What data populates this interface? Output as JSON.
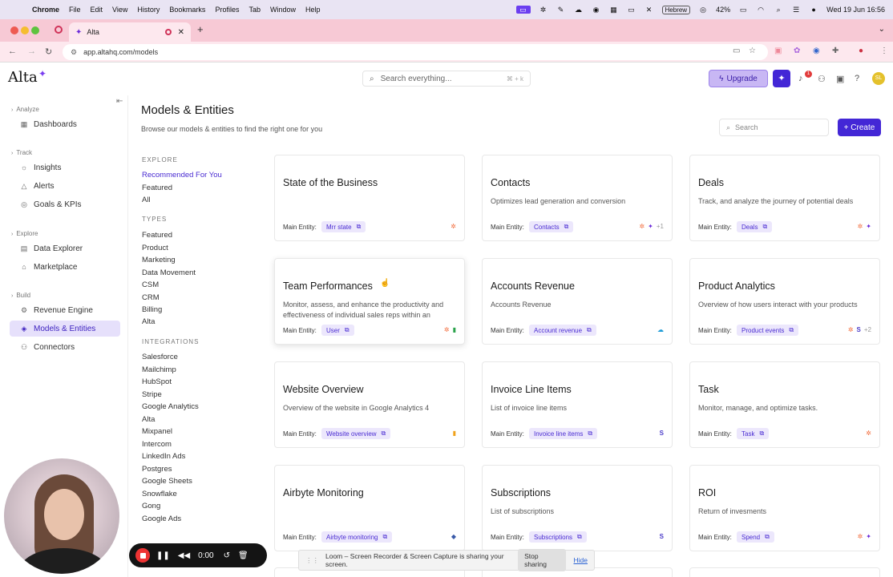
{
  "menubar": {
    "app": "Chrome",
    "items": [
      "File",
      "Edit",
      "View",
      "History",
      "Bookmarks",
      "Profiles",
      "Tab",
      "Window",
      "Help"
    ],
    "language": "Hebrew",
    "battery": "42%",
    "datetime": "Wed 19 Jun  16:56"
  },
  "browser": {
    "tab_title": "Alta",
    "url": "app.altahq.com/models"
  },
  "header": {
    "logo": "Alta",
    "search_placeholder": "Search everything...",
    "search_shortcut": "⌘ + k",
    "upgrade_label": "Upgrade",
    "notification_count": "1",
    "avatar_initials": "SL"
  },
  "sidebar": {
    "sections": [
      {
        "title": "Analyze",
        "items": [
          {
            "label": "Dashboards",
            "icon": "grid-icon"
          }
        ]
      },
      {
        "title": "Track",
        "items": [
          {
            "label": "Insights",
            "icon": "lightbulb-icon"
          },
          {
            "label": "Alerts",
            "icon": "alert-icon"
          },
          {
            "label": "Goals & KPIs",
            "icon": "target-icon"
          }
        ]
      },
      {
        "title": "Explore",
        "items": [
          {
            "label": "Data Explorer",
            "icon": "database-icon"
          },
          {
            "label": "Marketplace",
            "icon": "store-icon"
          }
        ]
      },
      {
        "title": "Build",
        "items": [
          {
            "label": "Revenue Engine",
            "icon": "engine-icon"
          },
          {
            "label": "Models & Entities",
            "icon": "cube-icon",
            "active": true
          },
          {
            "label": "Connectors",
            "icon": "plug-icon"
          }
        ]
      }
    ]
  },
  "main": {
    "title": "Models & Entities",
    "subtitle": "Browse our models & entities to find the right one for you",
    "search_placeholder": "Search",
    "create_label": "+ Create"
  },
  "filters": {
    "explore_heading": "EXPLORE",
    "explore": [
      "Recommended For You",
      "Featured",
      "All"
    ],
    "types_heading": "TYPES",
    "types": [
      "Featured",
      "Product",
      "Marketing",
      "Data Movement",
      "CSM",
      "CRM",
      "Billing",
      "Alta"
    ],
    "integrations_heading": "INTEGRATIONS",
    "integrations": [
      "Salesforce",
      "Mailchimp",
      "HubSpot",
      "Stripe",
      "Google Analytics",
      "Alta",
      "Mixpanel",
      "Intercom",
      "LinkedIn Ads",
      "Postgres",
      "Google Sheets",
      "Snowflake",
      "Gong",
      "Google Ads"
    ]
  },
  "main_entity_label": "Main Entity:",
  "cards": [
    {
      "title": "State of the Business",
      "desc": "",
      "entity": "Mrr state",
      "icons": [
        "hubspot-icon"
      ]
    },
    {
      "title": "Contacts",
      "desc": "Optimizes lead generation and conversion",
      "entity": "Contacts",
      "icons": [
        "hubspot-icon",
        "alta-icon"
      ],
      "more": "+1"
    },
    {
      "title": "Deals",
      "desc": "Track, and analyze the journey of potential deals",
      "entity": "Deals",
      "icons": [
        "hubspot-icon",
        "alta-icon"
      ]
    },
    {
      "title": "Team Performances",
      "desc": "Monitor, assess, and enhance the productivity and effectiveness of individual sales reps within an",
      "entity": "User",
      "icons": [
        "hubspot-icon",
        "google-sheets-icon"
      ]
    },
    {
      "title": "Accounts Revenue",
      "desc": "Accounts Revenue",
      "entity": "Account revenue",
      "icons": [
        "salesforce-icon"
      ]
    },
    {
      "title": "Product Analytics",
      "desc": "Overview of how users interact with your products",
      "entity": "Product events",
      "icons": [
        "hubspot-icon",
        "stripe-icon"
      ],
      "more": "+2"
    },
    {
      "title": "Website Overview",
      "desc": "Overview of the website in Google Analytics 4",
      "entity": "Website overview",
      "icons": [
        "google-analytics-icon"
      ]
    },
    {
      "title": "Invoice Line Items",
      "desc": "List of invoice line items",
      "entity": "Invoice line items",
      "icons": [
        "stripe-icon"
      ]
    },
    {
      "title": "Task",
      "desc": "Monitor, manage, and optimize tasks.",
      "entity": "Task",
      "icons": [
        "hubspot-icon"
      ]
    },
    {
      "title": "Airbyte Monitoring",
      "desc": "",
      "entity": "Airbyte monitoring",
      "icons": [
        "airbyte-icon"
      ]
    },
    {
      "title": "Subscriptions",
      "desc": "List of subscriptions",
      "entity": "Subscriptions",
      "icons": [
        "stripe-icon"
      ]
    },
    {
      "title": "ROI",
      "desc": "Return of invesments",
      "entity": "Spend",
      "icons": [
        "hubspot-icon",
        "alta-icon"
      ]
    }
  ],
  "loom": {
    "timer": "0:00",
    "share_message": "Loom – Screen Recorder & Screen Capture is sharing your screen.",
    "stop_sharing": "Stop sharing",
    "hide": "Hide"
  },
  "colors": {
    "accent": "#4327d6",
    "active_bg": "#e6e0fb",
    "tabstrip": "#f7c9d5"
  }
}
